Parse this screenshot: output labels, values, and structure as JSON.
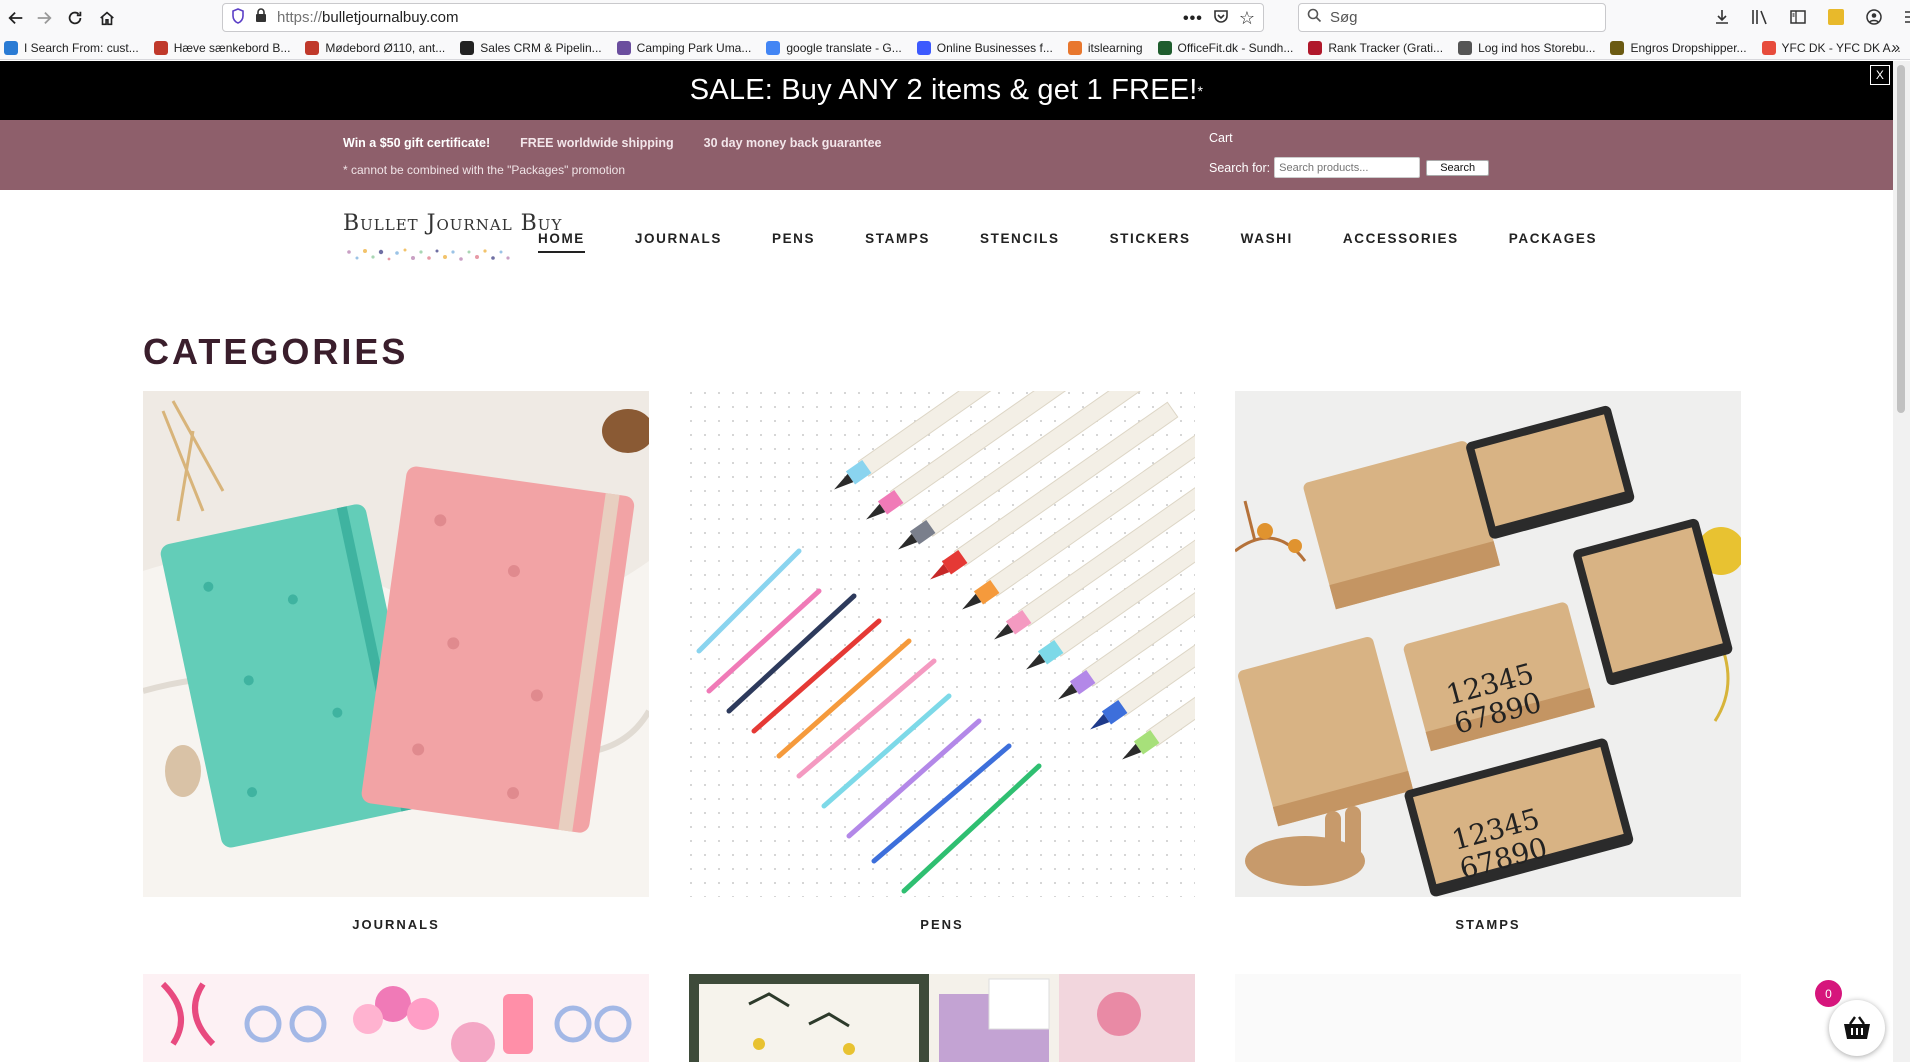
{
  "browser": {
    "url_scheme": "https://",
    "url_host": "bulletjournalbuy.com",
    "search_placeholder": "Søg",
    "bookmarks": [
      {
        "label": "I Search From: cust...",
        "color": "#2a7bd4"
      },
      {
        "label": "Hæve sænkebord B...",
        "color": "#c0392b"
      },
      {
        "label": "Mødebord Ø110, ant...",
        "color": "#c0392b"
      },
      {
        "label": "Sales CRM & Pipelin...",
        "color": "#222222"
      },
      {
        "label": "Camping Park Uma...",
        "color": "#6b4e9e"
      },
      {
        "label": "google translate - G...",
        "color": "#4285f4"
      },
      {
        "label": "Online Businesses f...",
        "color": "#3d5afe"
      },
      {
        "label": "itslearning",
        "color": "#e8772e"
      },
      {
        "label": "OfficeFit.dk - Sundh...",
        "color": "#1f5d2e"
      },
      {
        "label": "Rank Tracker (Grati...",
        "color": "#b0182b"
      },
      {
        "label": "Log ind hos Storebu...",
        "color": "#555555"
      },
      {
        "label": "Engros Dropshipper...",
        "color": "#6b5a12"
      },
      {
        "label": "YFC DK - YFC DK A...",
        "color": "#e74c3c"
      }
    ]
  },
  "promo": {
    "text": "SALE: Buy ANY 2 items & get 1 FREE!",
    "asterisk": "*",
    "close_label": "X"
  },
  "info_bar": {
    "links": [
      "Win a $50 gift certificate!",
      "FREE worldwide shipping",
      "30 day money back guarantee"
    ],
    "note": "* cannot be combined with the \"Packages\" promotion",
    "cart_label": "Cart",
    "search_label": "Search for:",
    "search_placeholder": "Search products...",
    "search_button": "Search"
  },
  "header": {
    "logo_text": "Bullet Journal Buy",
    "nav": [
      {
        "label": "HOME",
        "active": true
      },
      {
        "label": "JOURNALS",
        "active": false
      },
      {
        "label": "PENS",
        "active": false
      },
      {
        "label": "STAMPS",
        "active": false
      },
      {
        "label": "STENCILS",
        "active": false
      },
      {
        "label": "STICKERS",
        "active": false
      },
      {
        "label": "WASHI",
        "active": false
      },
      {
        "label": "ACCESSORIES",
        "active": false
      },
      {
        "label": "PACKAGES",
        "active": false
      }
    ]
  },
  "main": {
    "heading": "CATEGORIES",
    "categories": [
      {
        "label": "JOURNALS"
      },
      {
        "label": "PENS"
      },
      {
        "label": "STAMPS"
      }
    ]
  },
  "cart_widget": {
    "count": "0"
  },
  "colors": {
    "promo_bg": "#000000",
    "info_bar_bg": "#8e5f6b",
    "heading": "#3a1e2c",
    "cart_badge": "#d6157c"
  }
}
